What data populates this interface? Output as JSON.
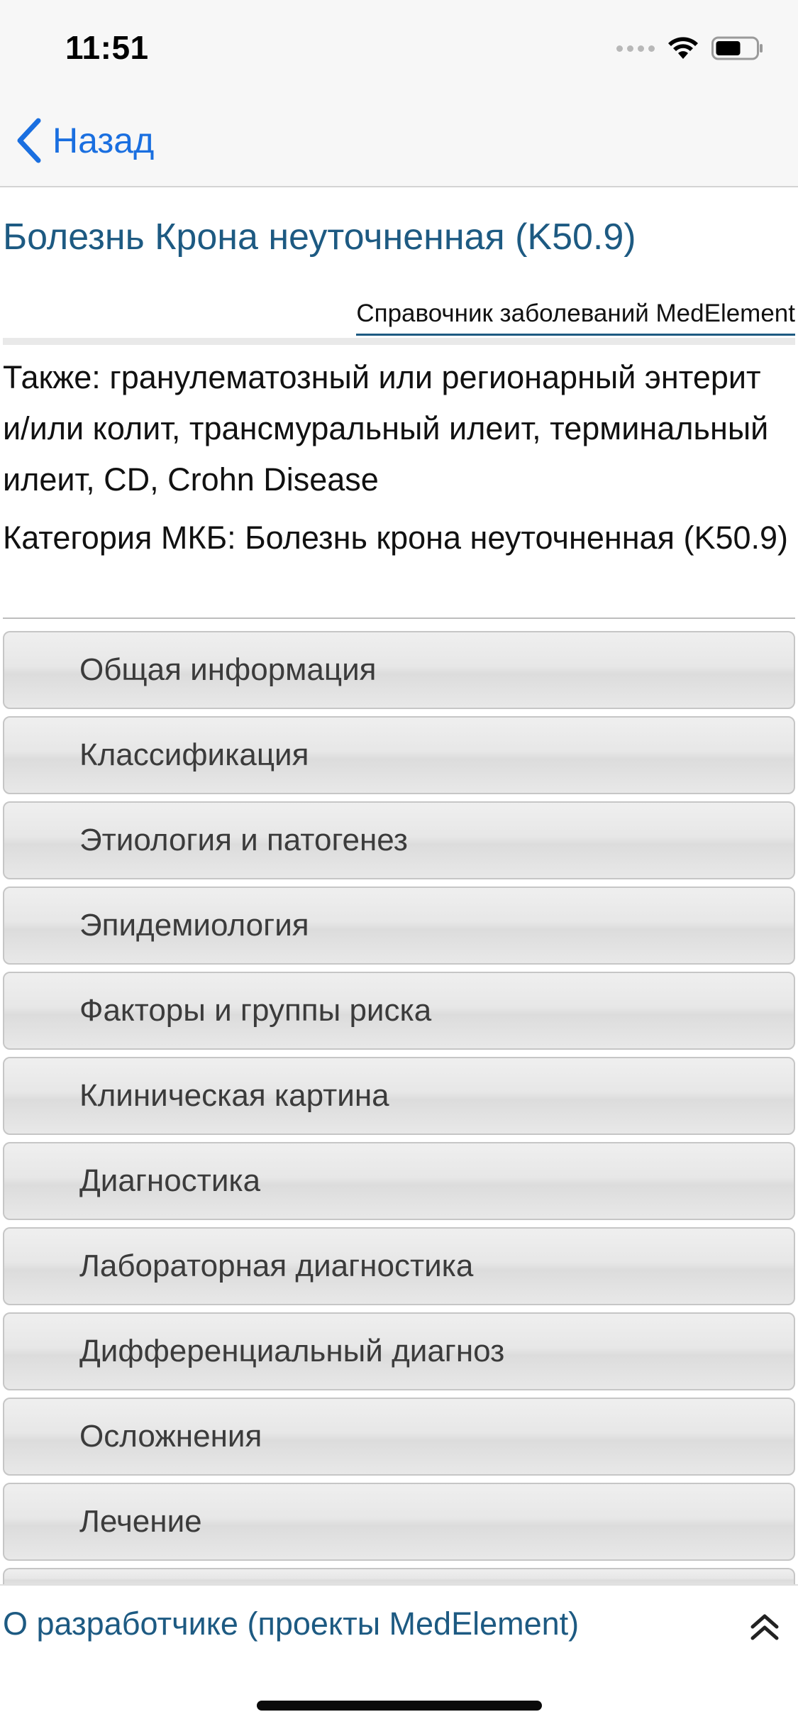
{
  "status_bar": {
    "time": "11:51"
  },
  "nav": {
    "back_label": "Назад"
  },
  "article": {
    "title": "Болезнь Крона неуточненная (K50.9)",
    "source": "Справочник заболеваний MedElement",
    "also": "Также: гранулематозный или регионарный энтерит и/или колит, трансмуральный илеит, терминальный илеит, CD, Crohn Disease",
    "mkb_category": "Категория МКБ: Болезнь крона неуточненная (K50.9)"
  },
  "sections": [
    {
      "label": "Общая информация"
    },
    {
      "label": "Классификация"
    },
    {
      "label": "Этиология и патогенез"
    },
    {
      "label": "Эпидемиология"
    },
    {
      "label": "Факторы и группы риска"
    },
    {
      "label": "Клиническая картина"
    },
    {
      "label": "Диагностика"
    },
    {
      "label": "Лабораторная диагностика"
    },
    {
      "label": "Дифференциальный диагноз"
    },
    {
      "label": "Осложнения"
    },
    {
      "label": "Лечение"
    }
  ],
  "footer": {
    "developer_link": "О разработчике (проекты MedElement)"
  },
  "colors": {
    "accent_link": "#1a6fe0",
    "title_blue": "#1d5a82"
  },
  "icons": {
    "back": "chevron-left-icon",
    "footer": "double-chevron-up-icon",
    "wifi": "wifi-icon",
    "battery": "battery-icon",
    "signal": "cellular-signal-icon"
  }
}
